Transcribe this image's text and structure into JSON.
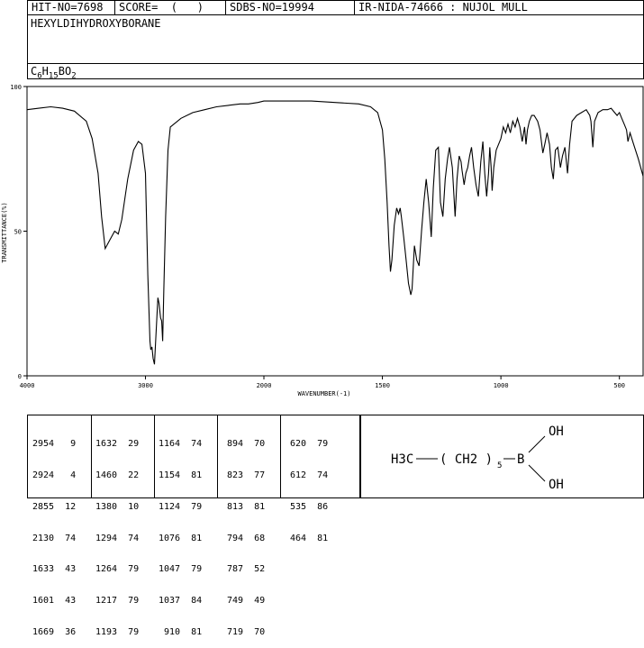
{
  "header": {
    "hit_no": "HIT-NO=7698",
    "score": "SCORE=  (   )",
    "sdbs_no": "SDBS-NO=19994",
    "ir_nida": "IR-NIDA-74666 : NUJOL MULL"
  },
  "compound_name": "HEXYLDIHYDROXYBORANE",
  "formula": {
    "c": "C",
    "c_n": "6",
    "h": "H",
    "h_n": "15",
    "rest": "BO",
    "o_n": "2"
  },
  "chart_data": {
    "type": "line",
    "xlabel": "WAVENUMBER(-1)",
    "ylabel": "TRANSMITTANCE(%)",
    "xlim": [
      4000,
      400
    ],
    "ylim": [
      0,
      100
    ],
    "x_ticks": [
      "4000",
      "3000",
      "2000",
      "1500",
      "1000",
      "500"
    ],
    "y_ticks": [
      "100",
      "50",
      "0"
    ],
    "series": [
      {
        "points": [
          [
            4000,
            92
          ],
          [
            3900,
            92.5
          ],
          [
            3800,
            93
          ],
          [
            3700,
            92.5
          ],
          [
            3600,
            91.5
          ],
          [
            3500,
            88
          ],
          [
            3450,
            82
          ],
          [
            3400,
            70
          ],
          [
            3370,
            55
          ],
          [
            3340,
            44
          ],
          [
            3300,
            47
          ],
          [
            3260,
            50
          ],
          [
            3230,
            49
          ],
          [
            3200,
            54
          ],
          [
            3150,
            68
          ],
          [
            3100,
            78
          ],
          [
            3060,
            81
          ],
          [
            3030,
            80
          ],
          [
            3000,
            70
          ],
          [
            2980,
            35
          ],
          [
            2962,
            12
          ],
          [
            2955,
            9
          ],
          [
            2945,
            10
          ],
          [
            2935,
            6
          ],
          [
            2924,
            4
          ],
          [
            2910,
            15
          ],
          [
            2895,
            27
          ],
          [
            2885,
            25
          ],
          [
            2872,
            20
          ],
          [
            2863,
            19
          ],
          [
            2855,
            12
          ],
          [
            2845,
            30
          ],
          [
            2830,
            55
          ],
          [
            2810,
            78
          ],
          [
            2790,
            86
          ],
          [
            2760,
            87
          ],
          [
            2700,
            89
          ],
          [
            2600,
            91
          ],
          [
            2500,
            92
          ],
          [
            2400,
            93
          ],
          [
            2300,
            93.5
          ],
          [
            2200,
            94
          ],
          [
            2130,
            94
          ],
          [
            2050,
            94.5
          ],
          [
            2000,
            95
          ],
          [
            1900,
            95
          ],
          [
            1800,
            95
          ],
          [
            1700,
            94.5
          ],
          [
            1600,
            94
          ],
          [
            1550,
            93
          ],
          [
            1520,
            91
          ],
          [
            1500,
            85
          ],
          [
            1490,
            75
          ],
          [
            1480,
            60
          ],
          [
            1472,
            45
          ],
          [
            1466,
            36
          ],
          [
            1460,
            40
          ],
          [
            1450,
            52
          ],
          [
            1440,
            58
          ],
          [
            1432,
            56
          ],
          [
            1425,
            58
          ],
          [
            1420,
            55
          ],
          [
            1410,
            48
          ],
          [
            1400,
            40
          ],
          [
            1390,
            32
          ],
          [
            1380,
            28
          ],
          [
            1375,
            30
          ],
          [
            1365,
            45
          ],
          [
            1355,
            40
          ],
          [
            1345,
            38
          ],
          [
            1335,
            50
          ],
          [
            1325,
            60
          ],
          [
            1315,
            68
          ],
          [
            1305,
            60
          ],
          [
            1294,
            48
          ],
          [
            1285,
            65
          ],
          [
            1275,
            78
          ],
          [
            1264,
            79
          ],
          [
            1255,
            60
          ],
          [
            1245,
            55
          ],
          [
            1235,
            68
          ],
          [
            1225,
            75
          ],
          [
            1217,
            79
          ],
          [
            1205,
            72
          ],
          [
            1193,
            55
          ],
          [
            1185,
            68
          ],
          [
            1176,
            76
          ],
          [
            1168,
            74
          ],
          [
            1164,
            71
          ],
          [
            1155,
            66
          ],
          [
            1148,
            70
          ],
          [
            1140,
            72
          ],
          [
            1132,
            76
          ],
          [
            1124,
            79
          ],
          [
            1115,
            72
          ],
          [
            1105,
            66
          ],
          [
            1095,
            62
          ],
          [
            1085,
            74
          ],
          [
            1076,
            81
          ],
          [
            1068,
            70
          ],
          [
            1060,
            62
          ],
          [
            1052,
            70
          ],
          [
            1047,
            79
          ],
          [
            1041,
            72
          ],
          [
            1037,
            64
          ],
          [
            1030,
            72
          ],
          [
            1020,
            78
          ],
          [
            1010,
            80
          ],
          [
            1000,
            82
          ],
          [
            990,
            86
          ],
          [
            980,
            84
          ],
          [
            970,
            87
          ],
          [
            960,
            84
          ],
          [
            950,
            88
          ],
          [
            940,
            86
          ],
          [
            930,
            89
          ],
          [
            920,
            86
          ],
          [
            910,
            81
          ],
          [
            900,
            86
          ],
          [
            894,
            80
          ],
          [
            888,
            85
          ],
          [
            880,
            88
          ],
          [
            870,
            90
          ],
          [
            860,
            90
          ],
          [
            845,
            88
          ],
          [
            835,
            85
          ],
          [
            823,
            77
          ],
          [
            815,
            80
          ],
          [
            805,
            84
          ],
          [
            795,
            80
          ],
          [
            787,
            72
          ],
          [
            779,
            68
          ],
          [
            770,
            78
          ],
          [
            760,
            79
          ],
          [
            749,
            72
          ],
          [
            740,
            76
          ],
          [
            730,
            79
          ],
          [
            719,
            70
          ],
          [
            710,
            80
          ],
          [
            700,
            88
          ],
          [
            680,
            90
          ],
          [
            660,
            91
          ],
          [
            640,
            92
          ],
          [
            625,
            90
          ],
          [
            620,
            88
          ],
          [
            612,
            79
          ],
          [
            605,
            88
          ],
          [
            590,
            91
          ],
          [
            570,
            92
          ],
          [
            550,
            92
          ],
          [
            535,
            92.5
          ],
          [
            520,
            91
          ],
          [
            510,
            90
          ],
          [
            500,
            91
          ],
          [
            490,
            89
          ],
          [
            480,
            87
          ],
          [
            470,
            85
          ],
          [
            464,
            81
          ],
          [
            455,
            84
          ],
          [
            440,
            80
          ],
          [
            420,
            75
          ],
          [
            400,
            69
          ]
        ]
      }
    ]
  },
  "peak_table": {
    "columns": [
      [
        "2954   9",
        "2924   4",
        "2855  12",
        "2130  74",
        "1633  43",
        "1601  43",
        "1669  36"
      ],
      [
        "1632  29",
        "1460  22",
        "1380  10",
        "1294  74",
        "1264  79",
        "1217  79",
        "1193  79"
      ],
      [
        "1164  74",
        "1154  81",
        "1124  79",
        "1076  81",
        "1047  79",
        "1037  84",
        " 910  81"
      ],
      [
        " 894  70",
        " 823  77",
        " 813  81",
        " 794  68",
        " 787  52",
        " 749  49",
        " 719  70"
      ],
      [
        " 620  79",
        " 612  74",
        " 535  86",
        " 464  81"
      ]
    ]
  },
  "structure": {
    "h3c": "H3C",
    "chain": "( CH2 )",
    "chain_n": "5",
    "boron": "B",
    "oh_top": "OH",
    "oh_bottom": "OH"
  }
}
